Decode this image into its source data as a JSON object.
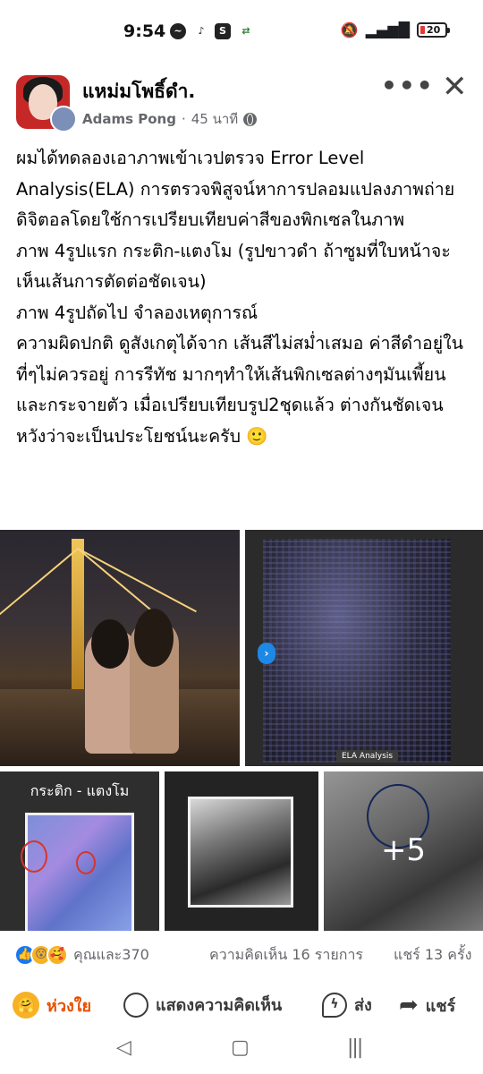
{
  "status_bar": {
    "time": "9:54",
    "battery": "20",
    "icons": [
      "messenger-icon",
      "tiktok-icon",
      "s-app-icon",
      "sync-icon",
      "mute-icon",
      "signal-icon",
      "battery-icon"
    ]
  },
  "post": {
    "group_name": "แหม่มโพธิ์ดำ.",
    "author": "Adams Pong",
    "time": "45 นาที",
    "separator": "·",
    "more": "•••",
    "close": "✕",
    "text": "ผมได้ทดลองเอาภาพเข้าเวปตรวจ Error Level Analysis(ELA) การตรวจพิสูจน์หาการปลอมแปลงภาพถ่ายดิจิตอลโดยใช้การเปรียบเทียบค่าสีของพิกเซลในภาพ\nภาพ 4รูปแรก กระติก-แตงโม (รูปขาวดำ ถ้าซูมที่ใบหน้าจะเห็นเส้นการตัดต่อชัดเจน)\nภาพ 4รูปถัดไป จำลองเหตุการณ์\nความผิดปกติ ดูสังเกตุได้จาก เส้นสีไม่สม่ำเสมอ ค่าสีดำอยู่ในที่ๆไม่ควรอยู่ การรีทัช มากๆทำให้เส้นพิกเซลต่างๆมันเพี้ยนและกระจายตัว เมื่อเปรียบเทียบรูป2ชุดแล้ว ต่างกันชัดเจน หวังว่าจะเป็นประโยชน์นะครับ 🙂"
  },
  "photos": {
    "ela_label": "ELA Analysis",
    "caption_3": "กระติก - แตงโม",
    "more_count": "+5"
  },
  "reactions": {
    "summary": "คุณและ370",
    "comments": "ความคิดเห็น 16 รายการ",
    "shares": "แชร์ 13 ครั้ง"
  },
  "actions": {
    "like": "ห่วงใย",
    "comment": "แสดงความคิดเห็น",
    "send": "ส่ง",
    "share": "แชร์"
  },
  "navbar": {
    "back": "◁",
    "home": "▢",
    "recents": "|||"
  }
}
